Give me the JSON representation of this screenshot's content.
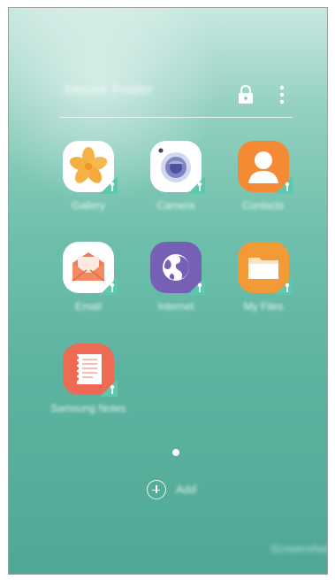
{
  "header": {
    "title": "Secure Folder"
  },
  "apps": [
    {
      "label": "Gallery",
      "icon": "gallery-icon"
    },
    {
      "label": "Camera",
      "icon": "camera-icon"
    },
    {
      "label": "Contacts",
      "icon": "contacts-icon"
    },
    {
      "label": "Email",
      "icon": "email-icon"
    },
    {
      "label": "Internet",
      "icon": "internet-icon"
    },
    {
      "label": "My Files",
      "icon": "my-files-icon"
    },
    {
      "label": "Samsung Notes",
      "icon": "samsung-notes-icon"
    }
  ],
  "footer": {
    "add_label": "Add",
    "corner_label": "Screenshot"
  },
  "colors": {
    "background_top": "#c9e8e0",
    "background_bottom": "#4fa896",
    "badge": "#5fc7ae"
  }
}
